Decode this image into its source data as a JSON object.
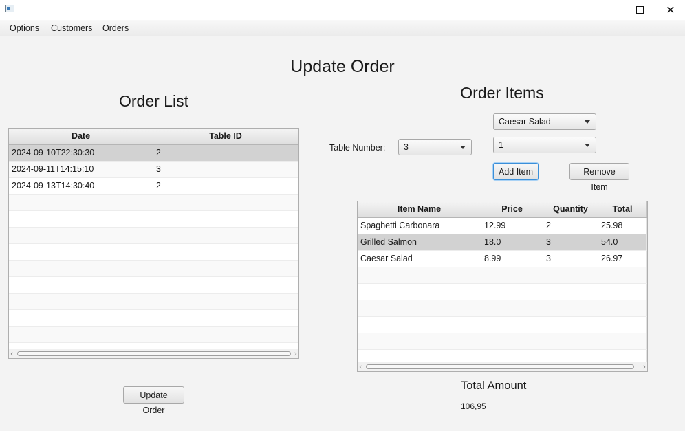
{
  "menu": [
    "Options",
    "Customers",
    "Orders"
  ],
  "page_title": "Update Order",
  "order_list": {
    "title": "Order List",
    "columns": [
      "Date",
      "Table ID"
    ],
    "rows": [
      [
        "2024-09-10T22:30:30",
        "2"
      ],
      [
        "2024-09-11T14:15:10",
        "3"
      ],
      [
        "2024-09-13T14:30:40",
        "2"
      ]
    ],
    "selected_row": 0
  },
  "order_items": {
    "title": "Order Items",
    "table_number_label": "Table Number:",
    "table_number_value": "3",
    "item_select_value": "Caesar Salad",
    "quantity_select_value": "1",
    "add_item_label": "Add Item",
    "remove_item_label": "Remove Item",
    "columns": [
      "Item Name",
      "Price",
      "Quantity",
      "Total"
    ],
    "rows": [
      [
        "Spaghetti Carbonara",
        "12.99",
        "2",
        "25.98"
      ],
      [
        "Grilled Salmon",
        "18.0",
        "3",
        "54.0"
      ],
      [
        "Caesar Salad",
        "8.99",
        "3",
        "26.97"
      ]
    ],
    "selected_row": 1
  },
  "update_order_label": "Update Order",
  "total_amount_label": "Total Amount",
  "total_amount_value": "106,95"
}
